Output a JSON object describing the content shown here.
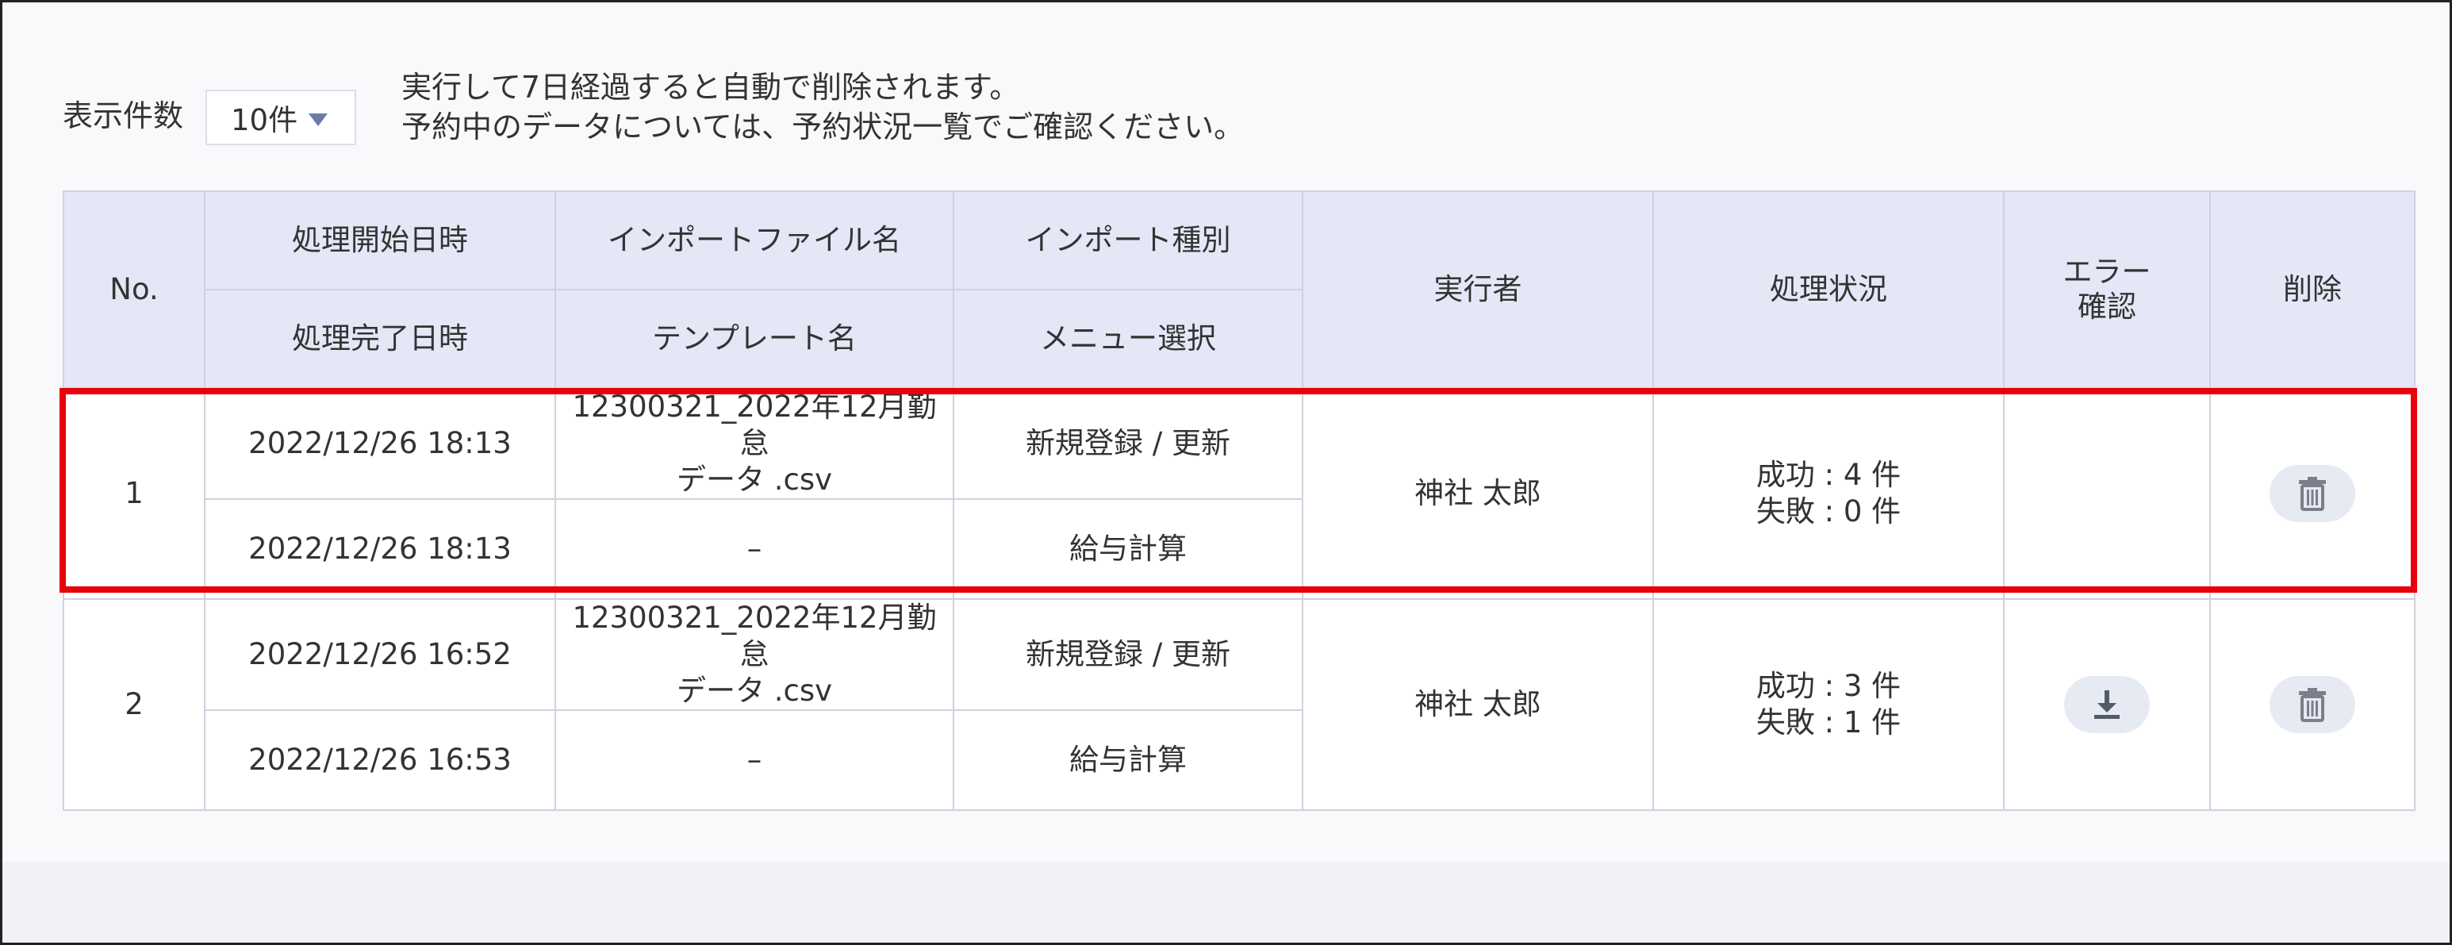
{
  "toolbar": {
    "count_label": "表示件数",
    "count_value": "10件",
    "notes": [
      "実行して7日経過すると自動で削除されます。",
      "予約中のデータについては、予約状況一覧でご確認ください。"
    ]
  },
  "table": {
    "headers": {
      "no": "No.",
      "start_datetime": "処理開始日時",
      "end_datetime": "処理完了日時",
      "import_file": "インポートファイル名",
      "template": "テンプレート名",
      "import_type": "インポート種別",
      "menu": "メニュー選択",
      "executor": "実行者",
      "status": "処理状況",
      "error_check": [
        "エラー",
        "確認"
      ],
      "delete": "削除"
    },
    "rows": [
      {
        "no": "1",
        "start": "2022/12/26 18:13",
        "end": "2022/12/26 18:13",
        "file": [
          "12300321_2022年12月勤怠",
          "データ .csv"
        ],
        "template": "–",
        "type": "新規登録 / 更新",
        "menu": "給与計算",
        "executor": "神社 太郎",
        "success": "成功 : 4 件",
        "failure": "失敗 : 0 件",
        "has_download": false
      },
      {
        "no": "2",
        "start": "2022/12/26 16:52",
        "end": "2022/12/26 16:53",
        "file": [
          "12300321_2022年12月勤怠",
          "データ .csv"
        ],
        "template": "–",
        "type": "新規登録 / 更新",
        "menu": "給与計算",
        "executor": "神社 太郎",
        "success": "成功 : 3 件",
        "failure": "失敗 : 1 件",
        "has_download": true
      }
    ]
  },
  "icons": {
    "dropdown": "caret-down-icon",
    "delete": "trash-icon",
    "download": "download-icon"
  },
  "colors": {
    "header_bg": "#e4e7f6",
    "highlight": "#e8000b",
    "caret": "#6b7aa8",
    "icon": "#7a7f8a",
    "icon_pill": "#e6eaf3"
  }
}
